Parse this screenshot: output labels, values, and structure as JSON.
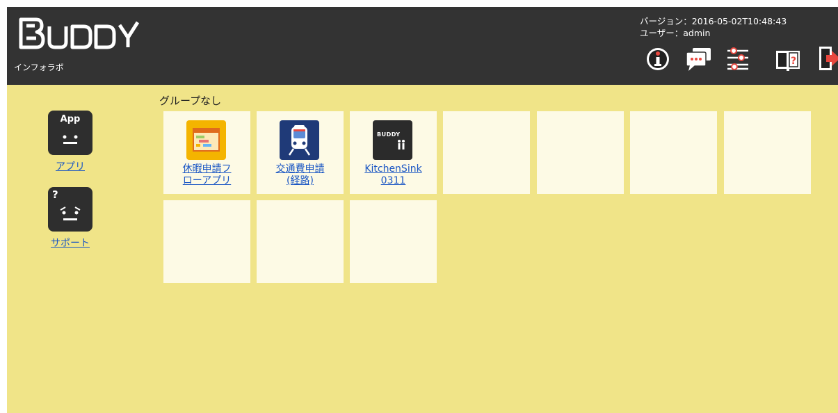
{
  "header": {
    "logo_text": "BUDDY",
    "subtitle": "インフォラボ",
    "version_line": "バージョン：2016-05-02T10:48:43",
    "user_line": "ユーザー：admin",
    "tools": [
      "info-icon",
      "chat-icon",
      "settings-sliders-icon",
      "help-book-icon",
      "logout-icon"
    ]
  },
  "sidebar": {
    "items": [
      {
        "label": "アプリ",
        "icon_text": "App",
        "icon": "app-face-icon"
      },
      {
        "label": "サポート",
        "icon_text": "?",
        "icon": "support-face-icon"
      }
    ]
  },
  "main": {
    "group_title": "グループなし",
    "apps": [
      {
        "line1": "休暇申請フ",
        "line2": "ローアプリ",
        "icon": "calendar-flow-icon"
      },
      {
        "line1": "交通費申請",
        "line2": "(経路)",
        "icon": "train-icon"
      },
      {
        "line1": "KitchenSink",
        "line2": "0311",
        "icon": "buddy-app-icon",
        "icon_text": "BUDDY"
      }
    ],
    "empty_tiles": 7
  },
  "colors": {
    "header_bg": "#333333",
    "content_bg": "#f0e488",
    "tile_bg": "#fdfae5",
    "link": "#1a56c4",
    "accent_red": "#e8473e"
  }
}
